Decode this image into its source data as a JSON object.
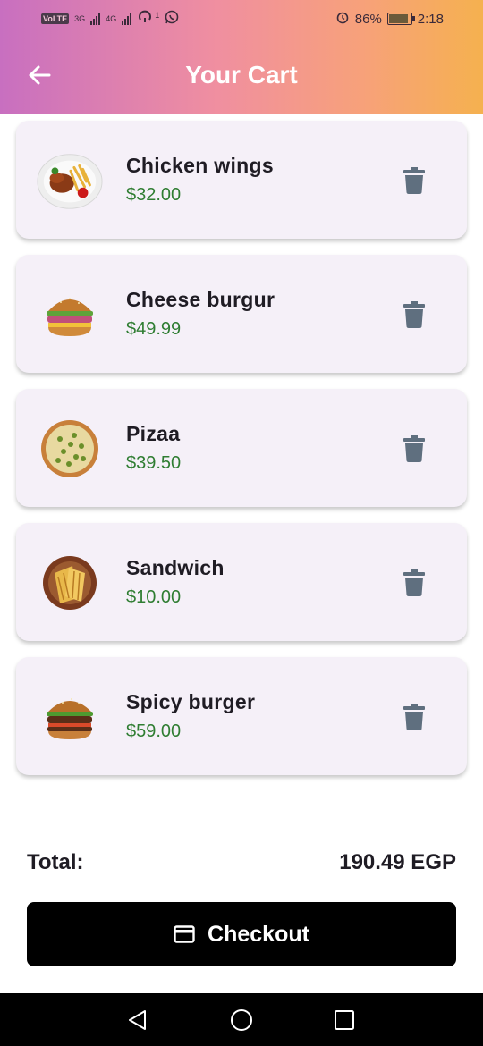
{
  "status_bar": {
    "network_badge": "VoLTE",
    "sim1_type": "3G",
    "sim2_type": "4G",
    "hotspot_count": "1",
    "battery": "86%",
    "time": "2:18"
  },
  "app_bar": {
    "title": "Your Cart"
  },
  "cart": {
    "items": [
      {
        "name": "Chicken wings",
        "price": "$32.00",
        "icon": "chicken-wings-plate"
      },
      {
        "name": "Cheese burgur",
        "price": "$49.99",
        "icon": "cheese-burger"
      },
      {
        "name": "Pizaa",
        "price": "$39.50",
        "icon": "pizza"
      },
      {
        "name": "Sandwich",
        "price": "$10.00",
        "icon": "grilled-sandwich"
      },
      {
        "name": "Spicy burger",
        "price": "$59.00",
        "icon": "spicy-burger"
      }
    ]
  },
  "summary": {
    "total_label": "Total:",
    "total_value": "190.49 EGP"
  },
  "checkout": {
    "label": "Checkout",
    "icon": "credit-card-icon"
  },
  "colors": {
    "price": "#2f7d32",
    "card_bg": "#f5f0f8",
    "delete_icon": "#5f6f7f",
    "button_bg": "#000000"
  }
}
